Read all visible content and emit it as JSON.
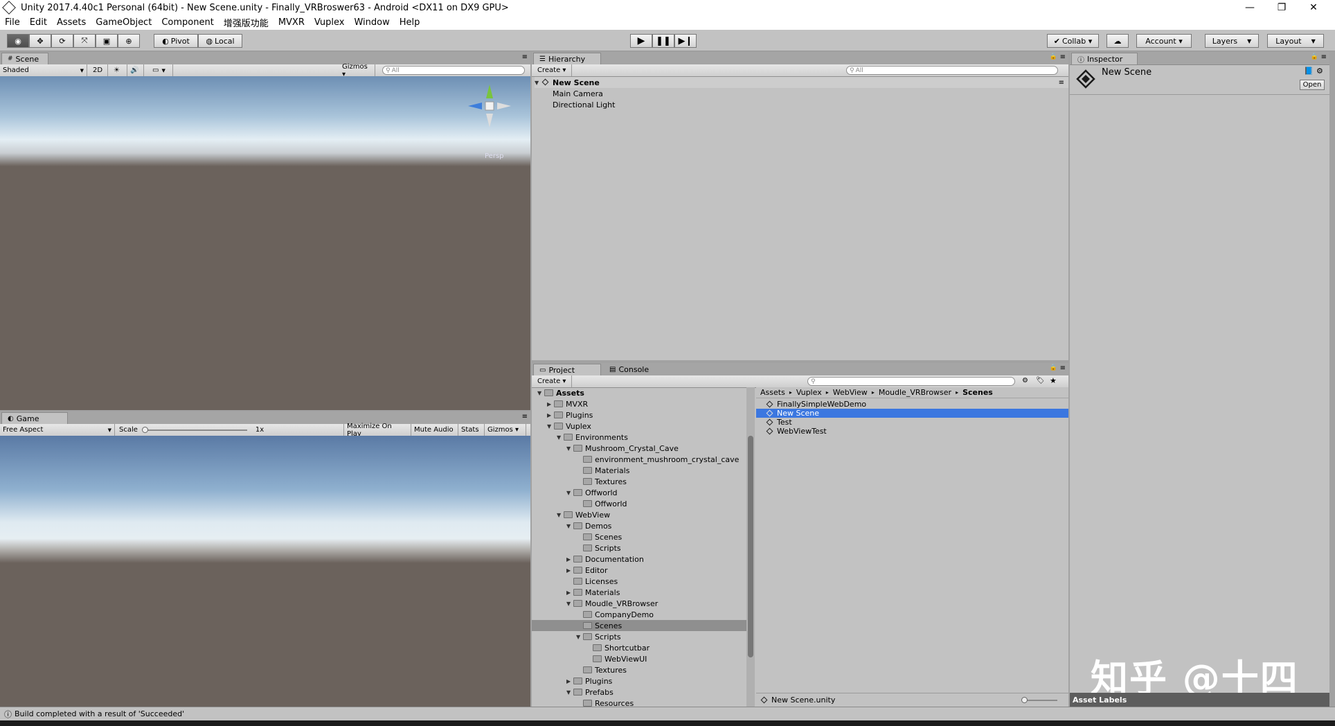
{
  "window": {
    "title": "Unity 2017.4.40c1 Personal (64bit) - New Scene.unity - Finally_VRBroswer63 - Android <DX11 on DX9 GPU>",
    "minimize": "—",
    "restore": "❐",
    "close": "✕"
  },
  "menu": [
    "File",
    "Edit",
    "Assets",
    "GameObject",
    "Component",
    "增强版功能",
    "MVXR",
    "Vuplex",
    "Window",
    "Help"
  ],
  "toolbar": {
    "pivot": "Pivot",
    "local": "Local",
    "collab": "Collab ▾",
    "account": "Account ▾",
    "layers": "Layers",
    "layout": "Layout"
  },
  "scene": {
    "tab": "Scene",
    "shading": "Shaded",
    "mode2d": "2D",
    "gizmos": "Gizmos ▾",
    "search_placeholder": "All",
    "persp": "Persp"
  },
  "game": {
    "tab": "Game",
    "aspect": "Free Aspect",
    "scale_label": "Scale",
    "scale_value": "1x",
    "maximize": "Maximize On Play",
    "mute": "Mute Audio",
    "stats": "Stats",
    "gizmos": "Gizmos ▾"
  },
  "hierarchy": {
    "tab": "Hierarchy",
    "create": "Create ▾",
    "search_placeholder": "All",
    "scene_name": "New Scene",
    "items": [
      "Main Camera",
      "Directional Light"
    ]
  },
  "project": {
    "tab": "Project",
    "console_tab": "Console",
    "create": "Create ▾",
    "breadcrumb": [
      "Assets",
      "Vuplex",
      "WebView",
      "Moudle_VRBrowser",
      "Scenes"
    ],
    "tree": [
      {
        "label": "Assets",
        "depth": 0,
        "arrow": "▼"
      },
      {
        "label": "MVXR",
        "depth": 1,
        "arrow": "▶"
      },
      {
        "label": "Plugins",
        "depth": 1,
        "arrow": "▶"
      },
      {
        "label": "Vuplex",
        "depth": 1,
        "arrow": "▼"
      },
      {
        "label": "Environments",
        "depth": 2,
        "arrow": "▼"
      },
      {
        "label": "Mushroom_Crystal_Cave",
        "depth": 3,
        "arrow": "▼"
      },
      {
        "label": "environment_mushroom_crystal_cave",
        "depth": 4,
        "arrow": ""
      },
      {
        "label": "Materials",
        "depth": 4,
        "arrow": ""
      },
      {
        "label": "Textures",
        "depth": 4,
        "arrow": ""
      },
      {
        "label": "Offworld",
        "depth": 3,
        "arrow": "▼"
      },
      {
        "label": "Offworld",
        "depth": 4,
        "arrow": ""
      },
      {
        "label": "WebView",
        "depth": 2,
        "arrow": "▼"
      },
      {
        "label": "Demos",
        "depth": 3,
        "arrow": "▼"
      },
      {
        "label": "Scenes",
        "depth": 4,
        "arrow": ""
      },
      {
        "label": "Scripts",
        "depth": 4,
        "arrow": ""
      },
      {
        "label": "Documentation",
        "depth": 3,
        "arrow": "▶"
      },
      {
        "label": "Editor",
        "depth": 3,
        "arrow": "▶"
      },
      {
        "label": "Licenses",
        "depth": 3,
        "arrow": ""
      },
      {
        "label": "Materials",
        "depth": 3,
        "arrow": "▶"
      },
      {
        "label": "Moudle_VRBrowser",
        "depth": 3,
        "arrow": "▼"
      },
      {
        "label": "CompanyDemo",
        "depth": 4,
        "arrow": ""
      },
      {
        "label": "Scenes",
        "depth": 4,
        "arrow": "",
        "selected": true
      },
      {
        "label": "Scripts",
        "depth": 4,
        "arrow": "▼"
      },
      {
        "label": "Shortcutbar",
        "depth": 5,
        "arrow": ""
      },
      {
        "label": "WebViewUI",
        "depth": 5,
        "arrow": ""
      },
      {
        "label": "Textures",
        "depth": 4,
        "arrow": ""
      },
      {
        "label": "Plugins",
        "depth": 3,
        "arrow": "▶"
      },
      {
        "label": "Prefabs",
        "depth": 3,
        "arrow": "▼"
      },
      {
        "label": "Resources",
        "depth": 4,
        "arrow": ""
      }
    ],
    "files": [
      {
        "label": "FinallySimpleWebDemo",
        "selected": false
      },
      {
        "label": "New Scene",
        "selected": true
      },
      {
        "label": "Test",
        "selected": false
      },
      {
        "label": "WebViewTest",
        "selected": false
      }
    ],
    "footer_file": "New Scene.unity"
  },
  "inspector": {
    "tab": "Inspector",
    "object_name": "New Scene",
    "open": "Open",
    "asset_labels": "Asset Labels"
  },
  "status": {
    "message": "Build completed with a result of 'Succeeded'"
  },
  "watermark": "知乎 @十四",
  "colors": {
    "selection": "#3b77e0",
    "panel_bg": "#c2c2c2",
    "sky_top": "#6d8fb4",
    "sky_horizon": "#e4eef4",
    "ground": "#6b625c"
  }
}
